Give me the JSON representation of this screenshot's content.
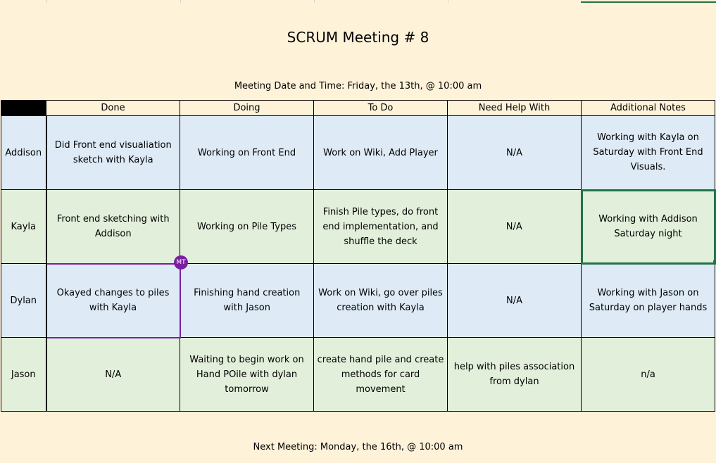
{
  "title": "SCRUM Meeting # 8",
  "meeting_date": "Meeting Date and Time: Friday, the 13th, @ 10:00 am",
  "next_meeting": "Next Meeting: Monday, the 16th, @ 10:00 am",
  "columns": [
    "Done",
    "Doing",
    "To Do",
    "Need Help With",
    "Additional Notes"
  ],
  "rows": [
    {
      "name": "Addison",
      "cells": [
        "Did Front end visualiation sketch with Kayla",
        "Working on Front End",
        "Work on Wiki, Add Player",
        "N/A",
        "Working with Kayla on Saturday with Front End Visuals."
      ]
    },
    {
      "name": "Kayla",
      "cells": [
        "Front end sketching with Addison",
        "Working on Pile Types",
        "Finish Pile types, do front end implementation, and shuffle the deck",
        "N/A",
        "Working with Addison Saturday night"
      ]
    },
    {
      "name": "Dylan",
      "cells": [
        "Okayed changes to piles with Kayla",
        "Finishing hand creation with Jason",
        "Work on Wiki, go over piles creation with Kayla",
        "N/A",
        "Working with Jason on Saturday on player hands"
      ]
    },
    {
      "name": "Jason",
      "cells": [
        "N/A",
        "Waiting to begin work on Hand POile with dylan tomorrow",
        "create hand pile and create methods for card movement",
        "help with piles association from dylan",
        "n/a"
      ]
    }
  ],
  "collaborator_badge": "MT",
  "colors": {
    "background": "#fef2d9",
    "row_blue": "#deeaf6",
    "row_green": "#e2efda",
    "selection_green": "#217346",
    "collaborator_purple": "#7a1fa2"
  }
}
